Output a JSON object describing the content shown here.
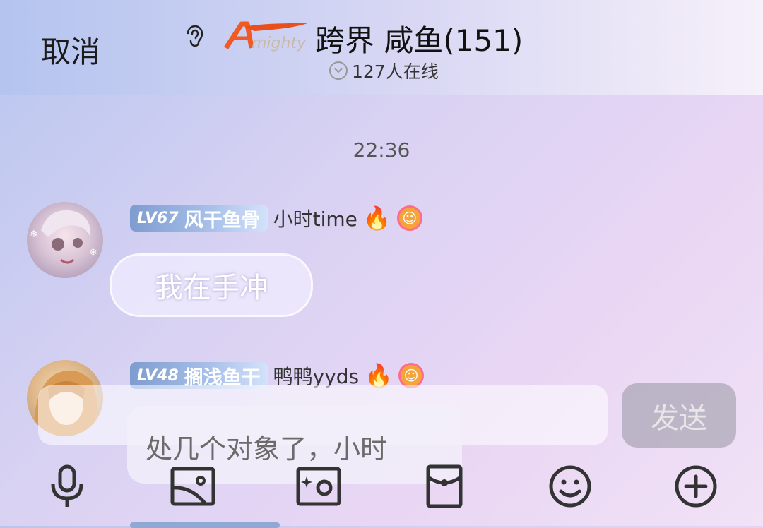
{
  "header": {
    "cancel_label": "取消",
    "logo_text": "Almighty",
    "group_title": "跨界 咸鱼(151)",
    "online_text": "127人在线"
  },
  "chat": {
    "timestamp": "22:36",
    "messages": [
      {
        "level": "LV67",
        "badge": "风干鱼骨",
        "sender": "小时time",
        "text": "我在手冲"
      },
      {
        "level": "LV48",
        "badge": "搁浅鱼干",
        "sender": "鸭鸭yyds",
        "text": "处几个对象了，小时"
      }
    ]
  },
  "composer": {
    "send_label": "发送"
  },
  "icons": {
    "ear": "ear-icon",
    "toolbar": [
      "microphone-icon",
      "image-icon",
      "camera-icon",
      "red-packet-icon",
      "emoji-icon",
      "plus-icon"
    ]
  }
}
